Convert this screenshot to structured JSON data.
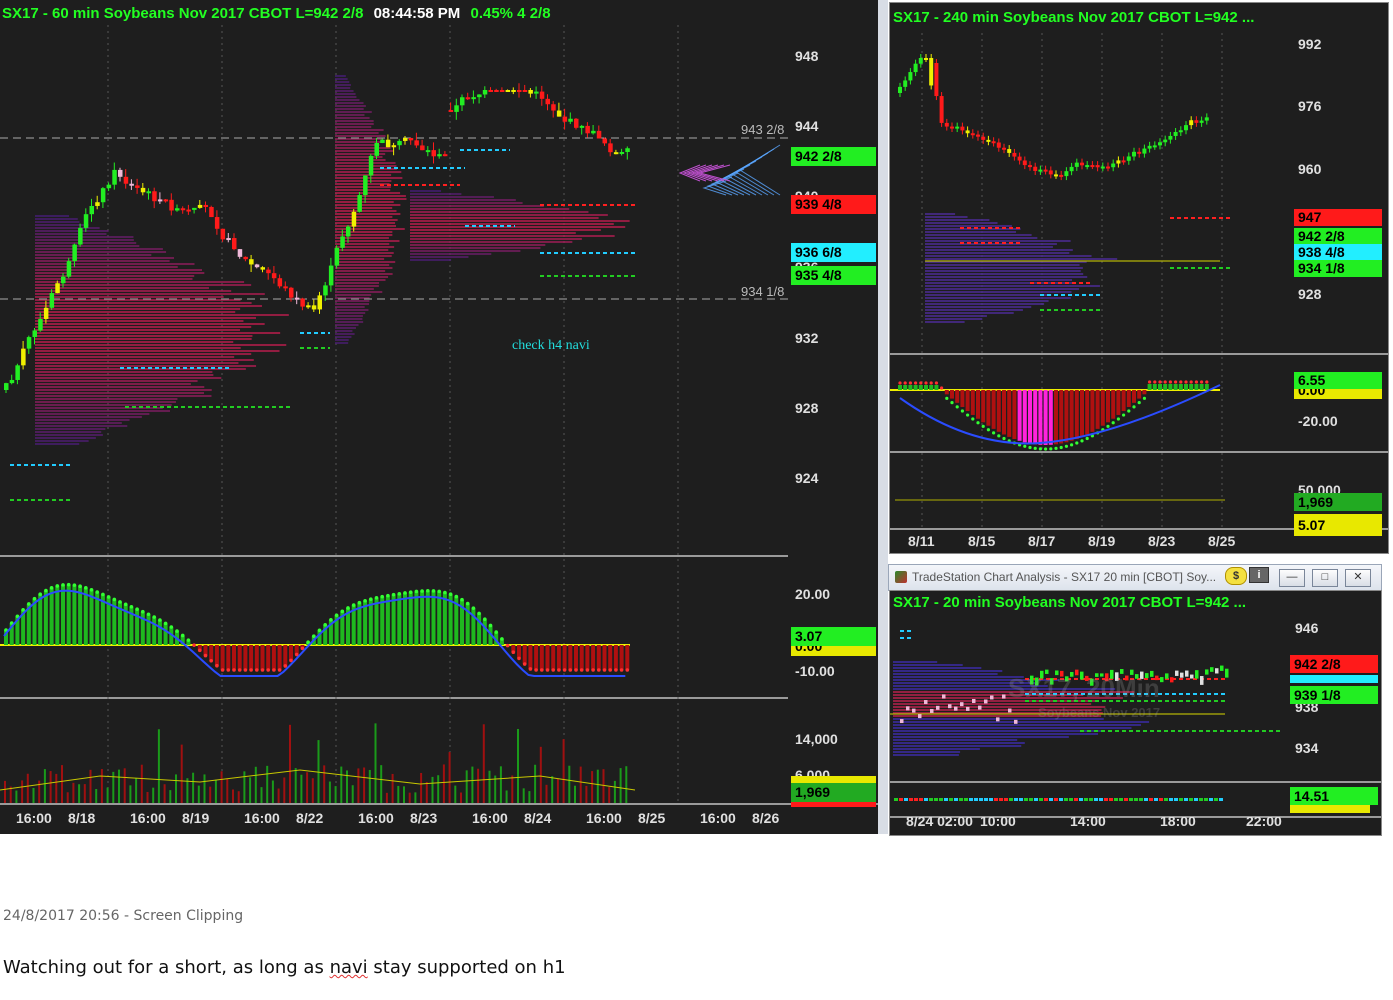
{
  "main_chart": {
    "title_parts": {
      "symbol": "SX17 - 60 min  Soybeans Nov 2017  CBOT  L=942 2/8",
      "time": "08:44:58 PM",
      "change": "0.45%  4 2/8"
    },
    "price_axis": [
      "948",
      "944",
      "940",
      "936",
      "932",
      "928",
      "924"
    ],
    "ref_levels": [
      "943 2/8",
      "934 1/8"
    ],
    "annotation": "check h4 navi",
    "tags": {
      "last": "942 2/8",
      "red": "939 4/8",
      "cyan": "936 6/8",
      "green": "935 4/8"
    },
    "osc_axis": [
      "20.00",
      "-10.00"
    ],
    "osc_tags": [
      "3.07",
      "0.00"
    ],
    "vol_axis": [
      "14,000",
      "6,000"
    ],
    "vol_tag": "1,969",
    "time_axis": [
      "16:00",
      "8/18",
      "16:00",
      "8/19",
      "16:00",
      "8/22",
      "16:00",
      "8/23",
      "16:00",
      "8/24",
      "16:00",
      "8/25",
      "16:00",
      "8/26"
    ]
  },
  "chart_240": {
    "title": "SX17 - 240 min  Soybeans Nov 2017  CBOT  L=942 ...",
    "price_axis": [
      "992",
      "976",
      "960",
      "928"
    ],
    "tags": {
      "red": "947",
      "green": "942 2/8",
      "cyan": "938 4/8",
      "green2": "934 1/8"
    },
    "osc_axis": [
      "-20.00"
    ],
    "osc_tags": [
      "6.55",
      "0.00"
    ],
    "vol_axis": [
      "50,000"
    ],
    "vol_tags": [
      "1,969",
      "5.07"
    ],
    "time_axis": [
      "8/11",
      "8/15",
      "8/17",
      "8/19",
      "8/23",
      "8/25"
    ]
  },
  "chart_20": {
    "window_title": "TradeStation Chart Analysis - SX17 20 min [CBOT] Soy...",
    "window_buttons": {
      "dollar": "$",
      "info": "i"
    },
    "title": "SX17 - 20 min  Soybeans Nov 2017  CBOT  L=942 ...",
    "watermark": "SX17, 20Min",
    "watermark_sub": "Soybeans Nov 2017",
    "price_axis": [
      "946",
      "938",
      "934"
    ],
    "tags": {
      "red": "942 2/8",
      "green": "939 1/8",
      "vol": "14.51"
    },
    "time_axis": [
      "8/24 02:00",
      "10:00",
      "14:00",
      "18:00",
      "22:00"
    ]
  },
  "clipping": {
    "timestamp": "24/8/2017 20:56 - Screen Clipping",
    "note_before": "Watching out for a short, as long as ",
    "note_misspelled": "navi",
    "note_after": " stay supported on h1"
  },
  "colors": {
    "up_bar": "#22ee22",
    "down_bar": "#ff1a1a",
    "yellow_bar": "#f0f000",
    "pink_bar": "#f0b8d8",
    "profile": "#4a2a90",
    "background": "#1e1e1e"
  }
}
